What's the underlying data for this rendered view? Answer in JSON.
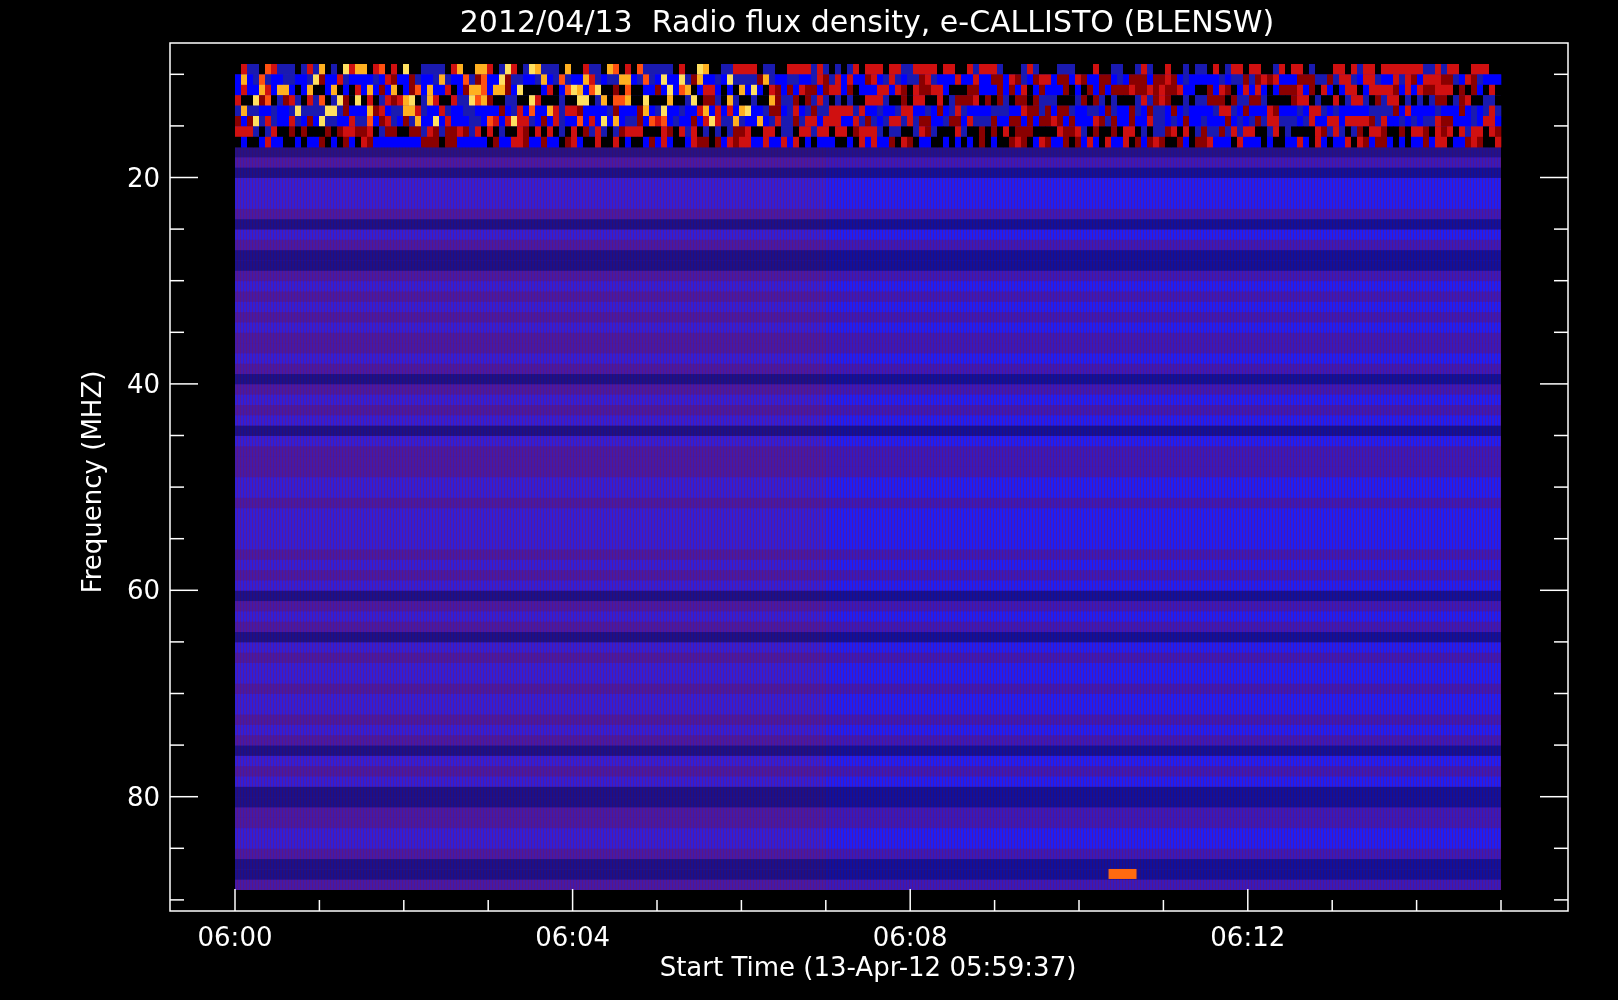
{
  "title": "2012/04/13  Radio flux density, e-CALLISTO (BLENSW)",
  "x_axis": {
    "label": "Start Time (13-Apr-12 05:59:37)",
    "ticks": [
      "06:00",
      "06:04",
      "06:08",
      "06:12"
    ]
  },
  "y_axis": {
    "label": "Frequency (MHZ)",
    "ticks": [
      "20",
      "40",
      "60",
      "80"
    ]
  }
}
